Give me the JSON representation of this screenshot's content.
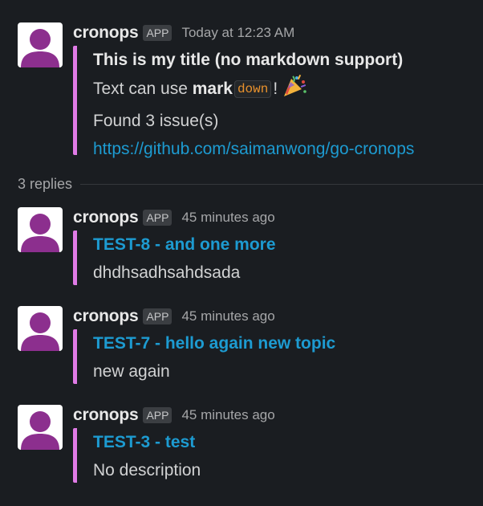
{
  "parent": {
    "author": "cronops",
    "badge": "APP",
    "time": "Today at 12:23 AM",
    "title": "This is my title (no markdown support)",
    "text_prefix": "Text can use ",
    "text_bold": "mark",
    "text_code": "down",
    "text_suffix": "!",
    "emoji": "party-popper-icon",
    "issues_line": "Found 3 issue(s)",
    "link": "https://github.com/saimanwong/go-cronops",
    "accent_color": "#e07be6"
  },
  "thread": {
    "replies_label": "3 replies"
  },
  "replies": [
    {
      "author": "cronops",
      "badge": "APP",
      "time": "45 minutes ago",
      "title": "TEST-8 - and one more",
      "body": "dhdhsadhsahdsada"
    },
    {
      "author": "cronops",
      "badge": "APP",
      "time": "45 minutes ago",
      "title": "TEST-7 - hello again new topic",
      "body": "new again"
    },
    {
      "author": "cronops",
      "badge": "APP",
      "time": "45 minutes ago",
      "title": "TEST-3 - test",
      "body": "No description"
    }
  ]
}
